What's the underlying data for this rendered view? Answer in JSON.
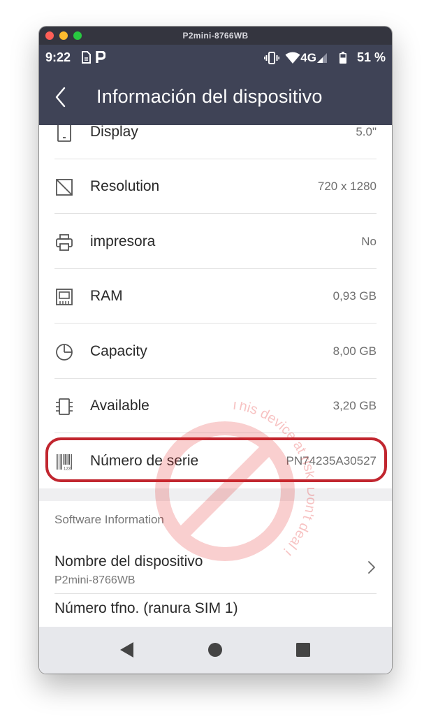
{
  "window": {
    "title": "P2mini-8766WB"
  },
  "status_bar": {
    "time": "9:22",
    "network": "4G",
    "battery": "51 %"
  },
  "app_bar": {
    "title": "Información del dispositivo"
  },
  "hardware_rows": [
    {
      "label": "Display",
      "value": "5.0\"",
      "icon": "display-icon"
    },
    {
      "label": "Resolution",
      "value": "720 x 1280",
      "icon": "resolution-icon"
    },
    {
      "label": "impresora",
      "value": "No",
      "icon": "printer-icon"
    },
    {
      "label": "RAM",
      "value": "0,93 GB",
      "icon": "ram-icon"
    },
    {
      "label": "Capacity",
      "value": "8,00 GB",
      "icon": "capacity-pie-icon"
    },
    {
      "label": "Available",
      "value": "3,20 GB",
      "icon": "chip-icon"
    },
    {
      "label": "Número de serie",
      "value": "PN74235A30527",
      "icon": "barcode-icon"
    }
  ],
  "software": {
    "section_title": "Software Information",
    "device_name_label": "Nombre del dispositivo",
    "device_name_value": "P2mini-8766WB",
    "phone_label": "Número tfno. (ranura SIM 1)"
  },
  "watermark": {
    "text": "This device at risk. Don't deal !",
    "color": "#e52a2a"
  },
  "colors": {
    "app_bar": "#3f4356",
    "highlight": "#c1262f"
  }
}
